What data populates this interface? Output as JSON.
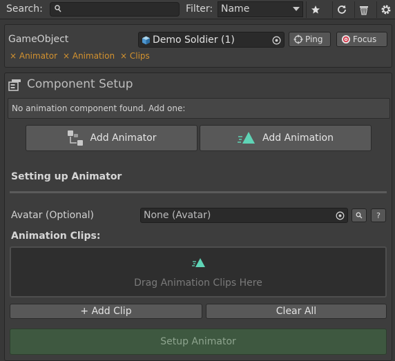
{
  "toolbar": {
    "search_label": "Search:",
    "search_value": "",
    "filter_label": "Filter:",
    "filter_value": "Name",
    "buttons": [
      "star-icon",
      "refresh-icon",
      "trash-icon",
      "gear-icon"
    ]
  },
  "gameobject": {
    "label": "GameObject",
    "field_value": "Demo Soldier (1)",
    "ping_label": "Ping",
    "focus_label": "Focus",
    "tags": [
      "× Animator",
      "× Animation",
      "× Clips"
    ],
    "tag_color": "#d3922f"
  },
  "component_setup": {
    "title": "Component Setup",
    "help_text": "No animation component found. Add one:",
    "add_animator_label": "Add Animator",
    "add_animation_label": "Add Animation"
  },
  "animator_setup": {
    "title": "Setting up Animator",
    "avatar_label": "Avatar (Optional)",
    "avatar_value": "None (Avatar)",
    "help_button": "?",
    "clips_label": "Animation Clips:",
    "drop_hint": "Drag Animation Clips Here",
    "add_clip_label": "+ Add Clip",
    "clear_all_label": "Clear All",
    "setup_label": "Setup Animator",
    "accent_color": "#5fd4b6",
    "setup_color": "#3e5840"
  }
}
